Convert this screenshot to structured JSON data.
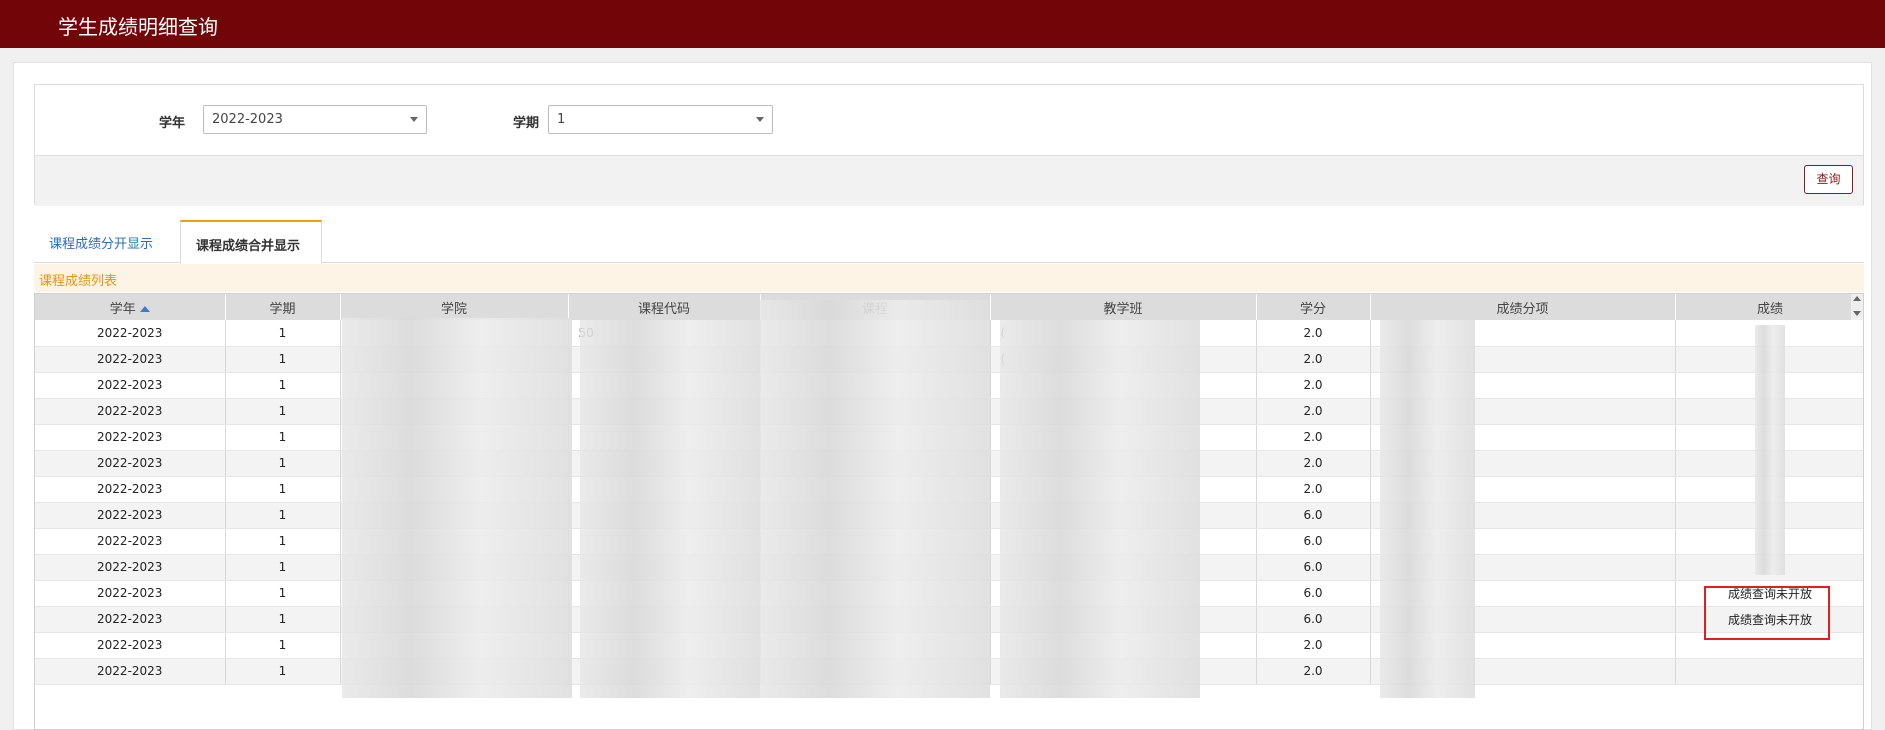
{
  "header": {
    "title": "学生成绩明细查询"
  },
  "filters": {
    "year_label": "学年",
    "year_value": "2022-2023",
    "term_label": "学期",
    "term_value": "1",
    "query_button": "查询"
  },
  "tabs": [
    {
      "label": "课程成绩分开显示",
      "active": false
    },
    {
      "label": "课程成绩合并显示",
      "active": true
    }
  ],
  "list_title": "课程成绩列表",
  "table": {
    "columns": [
      "学年",
      "学期",
      "学院",
      "课程代码",
      "课程",
      "教学班",
      "学分",
      "成绩分项",
      "成绩"
    ],
    "rows": [
      [
        "2022-2023",
        "1",
        "",
        "50",
        "",
        "(",
        "2.0",
        "",
        ""
      ],
      [
        "2022-2023",
        "1",
        "",
        "",
        "",
        "(",
        "2.0",
        "",
        ""
      ],
      [
        "2022-2023",
        "1",
        "",
        "",
        "",
        "",
        "2.0",
        "",
        ""
      ],
      [
        "2022-2023",
        "1",
        "",
        "",
        "",
        "",
        "2.0",
        "",
        ""
      ],
      [
        "2022-2023",
        "1",
        "",
        "",
        "",
        "",
        "2.0",
        "",
        ""
      ],
      [
        "2022-2023",
        "1",
        "",
        "",
        "",
        "",
        "2.0",
        "",
        ""
      ],
      [
        "2022-2023",
        "1",
        "",
        "",
        "",
        "",
        "2.0",
        "",
        ""
      ],
      [
        "2022-2023",
        "1",
        "",
        "",
        "",
        "",
        "6.0",
        "",
        ""
      ],
      [
        "2022-2023",
        "1",
        "",
        "",
        "",
        "",
        "6.0",
        "",
        ""
      ],
      [
        "2022-2023",
        "1",
        "",
        "",
        "",
        "",
        "6.0",
        "",
        ""
      ],
      [
        "2022-2023",
        "1",
        "",
        "",
        "",
        "",
        "6.0",
        "",
        "成绩查询未开放"
      ],
      [
        "2022-2023",
        "1",
        "",
        "",
        "",
        "",
        "6.0",
        "",
        "成绩查询未开放"
      ],
      [
        "2022-2023",
        "1",
        "",
        "",
        "",
        "",
        "2.0",
        "",
        ""
      ],
      [
        "2022-2023",
        "1",
        "",
        "",
        "",
        "",
        "2.0",
        "",
        ""
      ]
    ]
  },
  "colors": {
    "header_bg": "#720507",
    "tab_active_border": "#f0a000",
    "list_title": "#e8940a",
    "highlight": "#e02020"
  }
}
